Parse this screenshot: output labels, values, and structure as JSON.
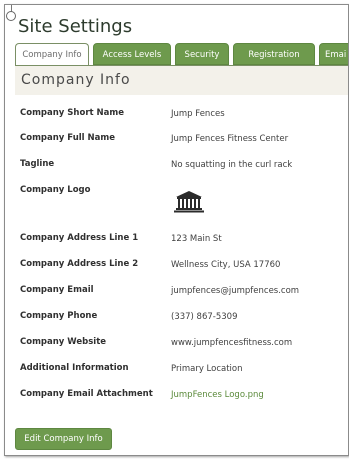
{
  "header": {
    "title": "Site Settings"
  },
  "tabs": [
    {
      "label": "Company Info",
      "active": true
    },
    {
      "label": "Access Levels",
      "active": false
    },
    {
      "label": "Security",
      "active": false
    },
    {
      "label": "Registration",
      "active": false
    },
    {
      "label": "Emai",
      "active": false
    }
  ],
  "section": {
    "title": "Company Info"
  },
  "fields": {
    "short_name": {
      "label": "Company Short Name",
      "value": "Jump Fences"
    },
    "full_name": {
      "label": "Company Full Name",
      "value": "Jump Fences Fitness Center"
    },
    "tagline": {
      "label": "Tagline",
      "value": "No squatting in the curl rack"
    },
    "logo": {
      "label": "Company Logo"
    },
    "address1": {
      "label": "Company Address Line 1",
      "value": "123 Main St"
    },
    "address2": {
      "label": "Company Address Line 2",
      "value": "Wellness City, USA 17760"
    },
    "email": {
      "label": "Company Email",
      "value": "jumpfences@jumpfences.com"
    },
    "phone": {
      "label": "Company Phone",
      "value": "(337) 867-5309"
    },
    "website": {
      "label": "Company Website",
      "value": "www.jumpfencesfitness.com"
    },
    "additional": {
      "label": "Additional Information",
      "value": "Primary Location"
    },
    "attachment": {
      "label": "Company Email Attachment",
      "value": "JumpFences Logo.png"
    }
  },
  "actions": {
    "edit_label": "Edit Company Info"
  },
  "colors": {
    "accent": "#6e9a4d",
    "link": "#5b8a3b",
    "section_bg": "#f3f1ea"
  }
}
